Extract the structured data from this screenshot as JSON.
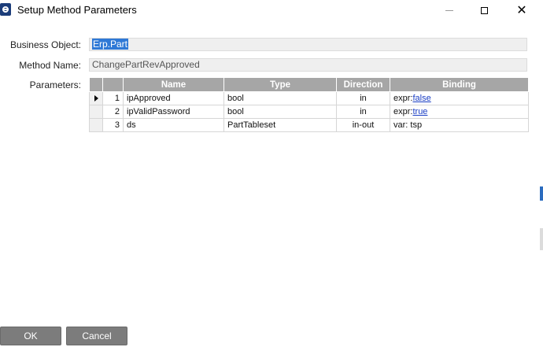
{
  "window": {
    "title": "Setup Method Parameters",
    "app_icon": "epicor-e-icon",
    "minimize_icon": "minimize-icon",
    "maximize_icon": "maximize-icon",
    "close_icon": "close-icon"
  },
  "form": {
    "business_object_label": "Business Object:",
    "business_object_value": "Erp.Part",
    "method_name_label": "Method Name:",
    "method_name_value": "ChangePartRevApproved",
    "parameters_label": "Parameters:"
  },
  "grid": {
    "columns": [
      "Name",
      "Type",
      "Direction",
      "Binding"
    ],
    "rows": [
      {
        "num": "1",
        "name": "ipApproved",
        "type": "bool",
        "direction": "in",
        "binding_prefix": "expr:",
        "binding_value": "false",
        "binding_link": true
      },
      {
        "num": "2",
        "name": "ipValidPassword",
        "type": "bool",
        "direction": "in",
        "binding_prefix": "expr:",
        "binding_value": "true",
        "binding_link": true
      },
      {
        "num": "3",
        "name": "ds",
        "type": "PartTableset",
        "direction": "in-out",
        "binding_prefix": "var: ",
        "binding_value": "tsp",
        "binding_link": false
      }
    ]
  },
  "buttons": {
    "ok": "OK",
    "cancel": "Cancel"
  }
}
